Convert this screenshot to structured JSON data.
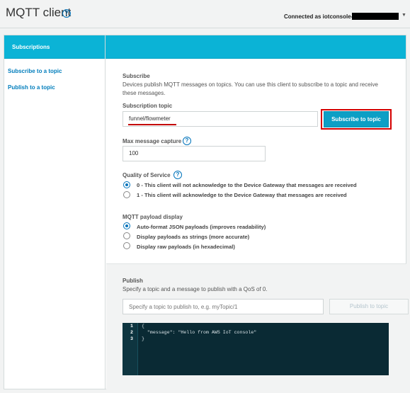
{
  "header": {
    "title": "MQTT client",
    "help_icon": "?",
    "connected_text": "Connected as iotconsole-",
    "account_menu_caret": "▼"
  },
  "sidebar": {
    "heading": "Subscriptions",
    "items": [
      {
        "label": "Subscribe to a topic"
      },
      {
        "label": "Publish to a topic"
      }
    ]
  },
  "subscribe": {
    "section_label": "Subscribe",
    "description": "Devices publish MQTT messages on topics. You can use this client to subscribe to a topic and receive these messages.",
    "topic_label": "Subscription topic",
    "topic_value": "funnel/flowmeter",
    "subscribe_button": "Subscribe to topic",
    "max_capture_label": "Max message capture",
    "max_capture_value": "100",
    "qos_label": "Quality of Service",
    "qos_options": [
      {
        "label": "0 - This client will not acknowledge to the Device Gateway that messages are received",
        "selected": true
      },
      {
        "label": "1 - This client will acknowledge to the Device Gateway that messages are received",
        "selected": false
      }
    ],
    "payload_label": "MQTT payload display",
    "payload_options": [
      {
        "label": "Auto-format JSON payloads (improves readability)",
        "selected": true
      },
      {
        "label": "Display payloads as strings (more accurate)",
        "selected": false
      },
      {
        "label": "Display raw payloads (in hexadecimal)",
        "selected": false
      }
    ]
  },
  "publish": {
    "section_label": "Publish",
    "description": "Specify a topic and a message to publish with a QoS of 0.",
    "topic_placeholder": "Specify a topic to publish to, e.g. myTopic/1",
    "publish_button": "Publish to topic",
    "editor": {
      "line_numbers": [
        "1",
        "2",
        "3"
      ],
      "lines": [
        "{",
        "  \"message\": \"Hello from AWS IoT console\"",
        "}"
      ]
    }
  },
  "colors": {
    "accent": "#0bb3d6",
    "primary_button": "#0c9fc5",
    "link": "#007dbc",
    "highlight_box": "#d50000",
    "editor_bg": "#0a2a34"
  }
}
